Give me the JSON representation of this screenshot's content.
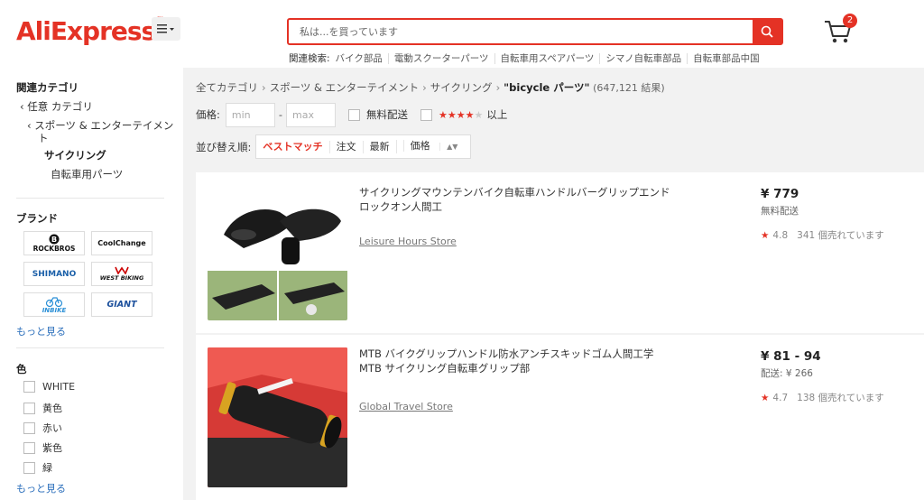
{
  "header": {
    "logo_text": "AliExpress",
    "logo_tm": "™",
    "search_placeholder": "私は...を買っています",
    "related_label": "関連検索:",
    "related": [
      "バイク部品",
      "電動スクーターパーツ",
      "自転車用スペアパーツ",
      "シマノ自転車部品",
      "自転車部品中国"
    ],
    "cart_count": "2",
    "accent": "#e43225"
  },
  "sidebar": {
    "category_title": "関連カテゴリ",
    "cat_any": "任意 カテゴリ",
    "cat_sports_1": "スポーツ & エンターテイメン",
    "cat_sports_2": "ト",
    "cat_cycling": "サイクリング",
    "cat_bike_parts": "自転車用パーツ",
    "brand_title": "ブランド",
    "brands": [
      "ROCKBROS",
      "CoolChange",
      "SHIMANO",
      "WEST BIKING",
      "INBIKE",
      "GIANT"
    ],
    "more1": "もっと見る",
    "color_title": "色",
    "colors": [
      "WHITE",
      "黄色",
      "赤い",
      "紫色",
      "緑"
    ],
    "more2": "もっと見る"
  },
  "main": {
    "breadcrumb": [
      "全てカテゴリ",
      "スポーツ & エンターテイメント",
      "サイクリング"
    ],
    "query": "\"bicycle パーツ\"",
    "result_count": "(647,121 結果)",
    "price_label": "価格:",
    "min_placeholder": "min",
    "max_placeholder": "max",
    "dash": "-",
    "free_shipping": "無料配送",
    "rating_filter_suffix": "以上",
    "sort_label": "並び替え順:",
    "sort_options": [
      "ベストマッチ",
      "注文",
      "最新",
      "価格"
    ]
  },
  "products": [
    {
      "title": "サイクリングマウンテンバイク自転車ハンドルバーグリップエンドロックオン人間工",
      "store": "Leisure Hours Store",
      "price": "¥ 779",
      "shipping": "無料配送",
      "rating": "4.8",
      "sold": "341 個売れています"
    },
    {
      "title_line1": "MTB バイクグリップハンドル防水アンチスキッドゴム人間工学",
      "title_line2": "MTB サイクリング自転車グリップ部",
      "store": "Global Travel Store",
      "price": "¥ 81 - 94",
      "shipping": "配送: ¥ 266",
      "rating": "4.7",
      "sold": "138 個売れています"
    }
  ]
}
